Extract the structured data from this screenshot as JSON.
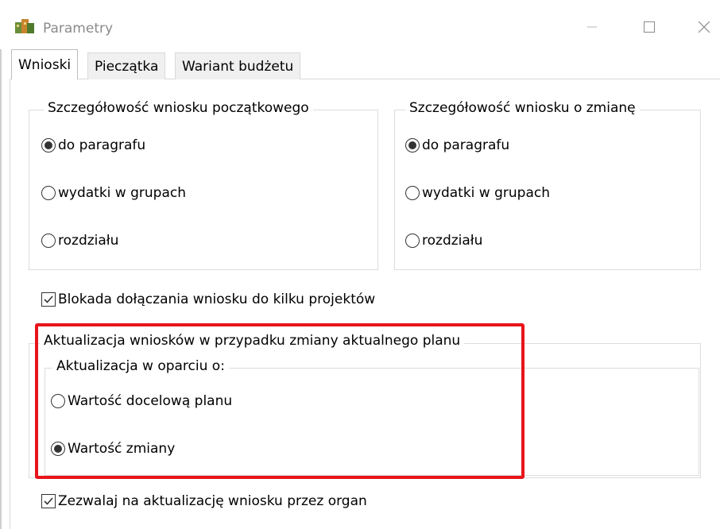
{
  "window": {
    "title": "Parametry"
  },
  "tabs": [
    {
      "label": "Wnioski"
    },
    {
      "label": "Pieczątka"
    },
    {
      "label": "Wariant budżetu"
    }
  ],
  "initial_group": {
    "legend": "Szczegółowość wniosku początkowego",
    "options": [
      {
        "label": "do paragrafu",
        "selected": true
      },
      {
        "label": "wydatki w grupach",
        "selected": false
      },
      {
        "label": "rozdziału",
        "selected": false
      }
    ]
  },
  "change_group": {
    "legend": "Szczegółowość wniosku o zmianę",
    "options": [
      {
        "label": "do paragrafu",
        "selected": true
      },
      {
        "label": "wydatki w grupach",
        "selected": false
      },
      {
        "label": "rozdziału",
        "selected": false
      }
    ]
  },
  "block_checkbox": {
    "label": "Blokada dołączania wniosku do kilku projektów",
    "checked": true
  },
  "update_group": {
    "legend": "Aktualizacja wniosków w przypadku zmiany aktualnego planu",
    "inner_legend": "Aktualizacja w oparciu o:",
    "options": [
      {
        "label": "Wartość docelową planu",
        "selected": false
      },
      {
        "label": "Wartość zmiany",
        "selected": true
      }
    ]
  },
  "allow_checkbox": {
    "label": "Zezwalaj na aktualizację wniosku przez organ",
    "checked": true
  },
  "colors": {
    "highlight": "#e8141b",
    "title_text": "#8a8a8a",
    "tab_bg": "#f0f0f0"
  },
  "icons": {
    "app": "app-icon",
    "minimize": "minimize-icon",
    "maximize": "maximize-icon",
    "close": "close-icon"
  }
}
